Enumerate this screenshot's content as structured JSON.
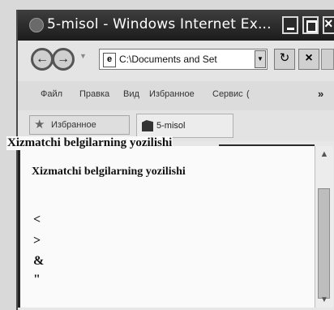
{
  "window": {
    "title": "5-misol - Windows Internet Ex...",
    "icons": {
      "app": "ie-icon",
      "minimize": "minimize-icon",
      "maximize": "maximize-icon",
      "close": "close-icon"
    }
  },
  "nav": {
    "address": "C:\\Documents and Set",
    "icons": {
      "back": "back-arrow-icon",
      "forward": "forward-arrow-icon",
      "refresh": "refresh-icon",
      "stop": "stop-icon",
      "page": "page-icon"
    },
    "back_glyph": "←",
    "forward_glyph": "→",
    "refresh_glyph": "↻",
    "stop_glyph": "×",
    "page_glyph": "e"
  },
  "menu": {
    "items": [
      "Файл",
      "Правка",
      "Вид",
      "Избранное",
      "Сервис",
      "("
    ],
    "overflow": "»"
  },
  "favorites": {
    "label": "Избранное",
    "tab_label": "5-misol",
    "star_glyph": "★"
  },
  "document": {
    "window_caption": "Xizmatchi belgilarning yozilishi",
    "heading": "Xizmatchi belgilarning yozilishi",
    "symbols": [
      "<",
      ">",
      "&",
      "\""
    ]
  },
  "scrollbar": {
    "up_glyph": "▲",
    "down_glyph": "▼"
  }
}
